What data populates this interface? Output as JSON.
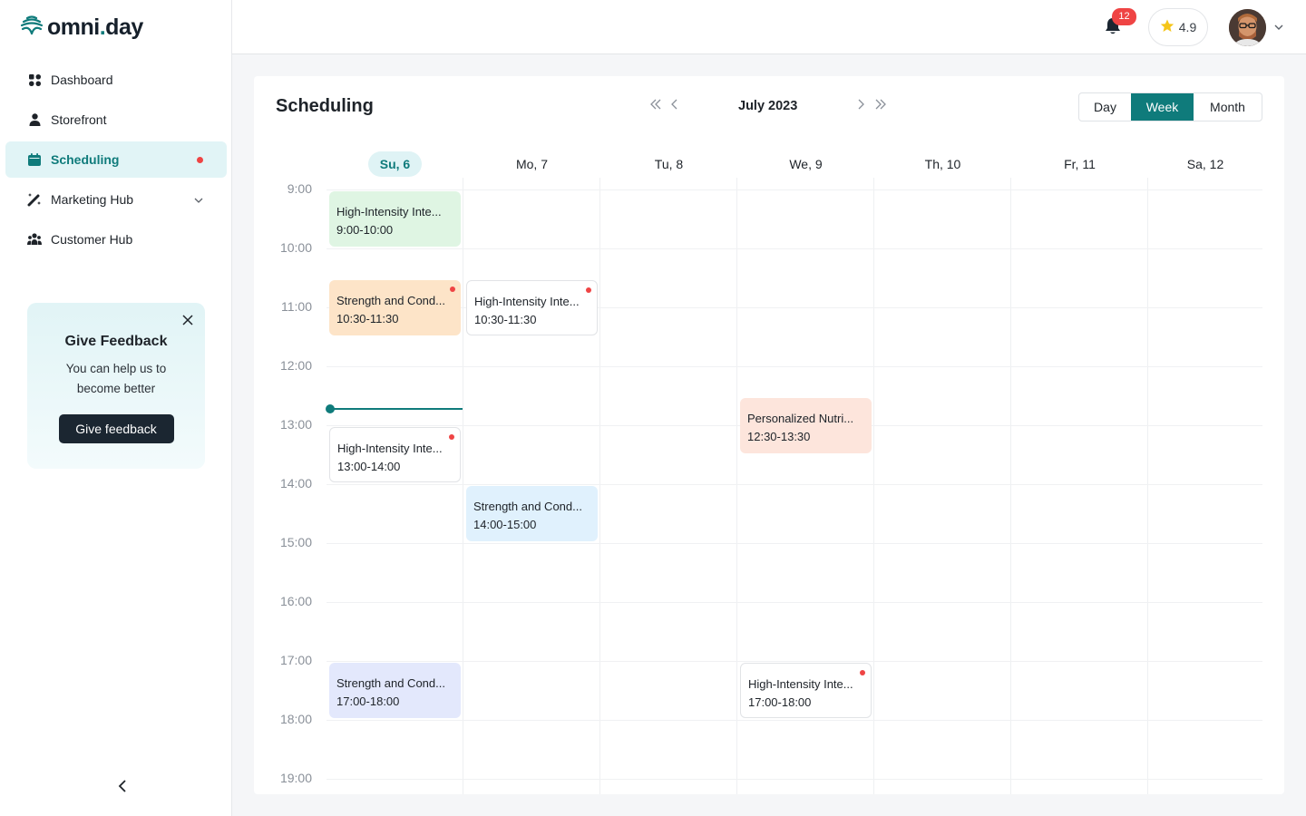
{
  "app": {
    "logo_text_a": "omni",
    "logo_text_dot": ".",
    "logo_text_b": "day"
  },
  "sidebar": {
    "items": [
      {
        "label": "Dashboard",
        "icon": "dashboard-grid-icon"
      },
      {
        "label": "Storefront",
        "icon": "user-icon"
      },
      {
        "label": "Scheduling",
        "icon": "calendar-icon",
        "active": true,
        "has_dot": true
      },
      {
        "label": "Marketing Hub",
        "icon": "magic-wand-icon",
        "expandable": true
      },
      {
        "label": "Customer Hub",
        "icon": "users-group-icon"
      }
    ],
    "feedback": {
      "title": "Give Feedback",
      "body": "You can help us to become better",
      "button": "Give feedback"
    }
  },
  "topbar": {
    "notifications_count": "12",
    "rating": "4.9"
  },
  "scheduling": {
    "title": "Scheduling",
    "month_label": "July 2023",
    "views": [
      "Day",
      "Week",
      "Month"
    ],
    "active_view": "Week",
    "days": [
      "Su, 6",
      "Mo, 7",
      "Tu, 8",
      "We, 9",
      "Th, 10",
      "Fr, 11",
      "Sa, 12"
    ],
    "today_index": 0,
    "hours": [
      "9:00",
      "10:00",
      "11:00",
      "12:00",
      "13:00",
      "14:00",
      "15:00",
      "16:00",
      "17:00",
      "18:00",
      "19:00"
    ],
    "current_time": "12:45",
    "events": [
      {
        "title": "High-Intensity Inte...",
        "time": "9:00-10:00",
        "day": 0,
        "start": 9.0,
        "end": 10.0,
        "style": "green",
        "dot": false
      },
      {
        "title": "Strength and Cond...",
        "time": "10:30-11:30",
        "day": 0,
        "start": 10.5,
        "end": 11.5,
        "style": "orange",
        "dot": true
      },
      {
        "title": "High-Intensity Inte...",
        "time": "10:30-11:30",
        "day": 1,
        "start": 10.5,
        "end": 11.5,
        "style": "outlined",
        "dot": true
      },
      {
        "title": "Personalized Nutri...",
        "time": "12:30-13:30",
        "day": 3,
        "start": 12.5,
        "end": 13.5,
        "style": "peach",
        "dot": false
      },
      {
        "title": "High-Intensity Inte...",
        "time": "13:00-14:00",
        "day": 0,
        "start": 13.0,
        "end": 14.0,
        "style": "outlined",
        "dot": true
      },
      {
        "title": "Strength and Cond...",
        "time": "14:00-15:00",
        "day": 1,
        "start": 14.0,
        "end": 15.0,
        "style": "blue",
        "dot": false
      },
      {
        "title": "Strength and Cond...",
        "time": "17:00-18:00",
        "day": 0,
        "start": 17.0,
        "end": 18.0,
        "style": "lavender",
        "dot": false
      },
      {
        "title": "High-Intensity Inte...",
        "time": "17:00-18:00",
        "day": 3,
        "start": 17.0,
        "end": 18.0,
        "style": "outlined",
        "dot": true
      }
    ],
    "event_colors": {
      "green": "#dff5e3",
      "orange": "#fde4c8",
      "peach": "#fde5dc",
      "blue": "#e0f1fd",
      "lavender": "#e3e8fc",
      "outlined": "#ffffff"
    },
    "accent": "#0f7b7b"
  }
}
